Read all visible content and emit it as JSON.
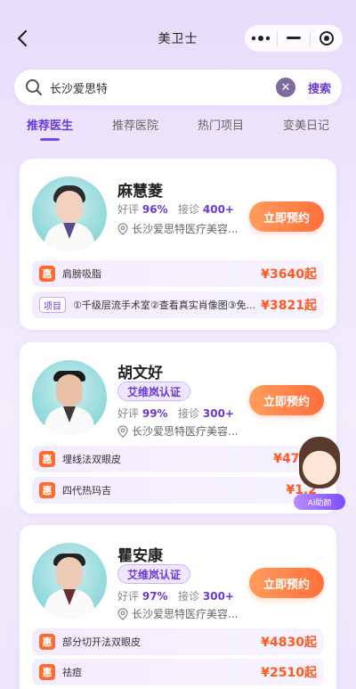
{
  "nav": {
    "title": "美卫士"
  },
  "search": {
    "value": "长沙爱思特",
    "button": "搜索"
  },
  "tabs": [
    {
      "label": "推荐医生",
      "active": true
    },
    {
      "label": "推荐医院",
      "active": false
    },
    {
      "label": "热门项目",
      "active": false
    },
    {
      "label": "变美日记",
      "active": false
    }
  ],
  "doctors": [
    {
      "name": "麻慧菱",
      "certification": "",
      "rating_label": "好评",
      "rating": "96%",
      "consult_label": "接诊",
      "consults": "400+",
      "hospital": "长沙爱思特医疗美容...",
      "book": "立即预约",
      "rows": [
        {
          "tag": "惠",
          "text": "肩膀吸脂",
          "price": "¥3640起"
        },
        {
          "tag": "项目",
          "text": "①千级层流手术室②查看真实肖像图③免...",
          "price": "¥3821起"
        }
      ]
    },
    {
      "name": "胡文好",
      "certification": "艾维岚认证",
      "rating_label": "好评",
      "rating": "99%",
      "consult_label": "接诊",
      "consults": "300+",
      "hospital": "长沙爱思特医疗美容...",
      "book": "立即预约",
      "rows": [
        {
          "tag": "惠",
          "text": "埋线法双眼皮",
          "price": "¥4790"
        },
        {
          "tag": "惠",
          "text": "四代热玛吉",
          "price": "¥1.2"
        }
      ]
    },
    {
      "name": "瞿安康",
      "certification": "艾维岚认证",
      "rating_label": "好评",
      "rating": "97%",
      "consult_label": "接诊",
      "consults": "300+",
      "hospital": "长沙爱思特医疗美容...",
      "book": "立即预约",
      "rows": [
        {
          "tag": "惠",
          "text": "部分切开法双眼皮",
          "price": "¥4830起"
        },
        {
          "tag": "惠",
          "text": "祛痘",
          "price": "¥2510起"
        }
      ]
    }
  ],
  "ai_assistant": {
    "label": "AI助颜"
  },
  "colors": {
    "accent": "#6a3ad6",
    "orange": "#ff6f3c",
    "price": "#ff5a1f"
  }
}
